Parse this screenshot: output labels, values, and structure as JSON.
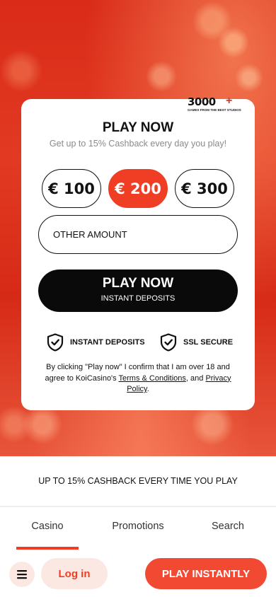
{
  "brand": {
    "badge_number": "3000",
    "badge_plus": "+",
    "badge_caption": "GAMES FROM THE BEST STUDIOS"
  },
  "offer": {
    "title": "PLAY NOW",
    "subtitle": "Get up to 15% Cashback every day you play!",
    "amounts": [
      "€ 100",
      "€ 200",
      "€ 300"
    ],
    "selected_amount": "€ 200",
    "other_amount_placeholder": "OTHER AMOUNT",
    "play_button": "PLAY NOW",
    "play_button_sub": "INSTANT DEPOSITS",
    "features": [
      "INSTANT DEPOSITS",
      "SSL SECURE"
    ],
    "legal_prefix": "By clicking \"Play now\" I confirm that I am over 18 and agree to KoiCasino's ",
    "legal_terms_link": "Terms & Conditions",
    "legal_middle": ", and ",
    "legal_privacy_link": "Privacy Policy",
    "legal_suffix": "."
  },
  "banner": {
    "cashback_text": "UP TO 15% CASHBACK EVERY TIME YOU PLAY"
  },
  "tabs": [
    "Casino",
    "Promotions",
    "Search"
  ],
  "active_tab": "Casino",
  "bottom_bar": {
    "login_label": "Log in",
    "play_instantly_label": "PLAY INSTANTLY"
  },
  "colors": {
    "accent": "#ef3e24",
    "dark_button": "#0a0a0a",
    "soft_pink": "#fbe8e2"
  }
}
